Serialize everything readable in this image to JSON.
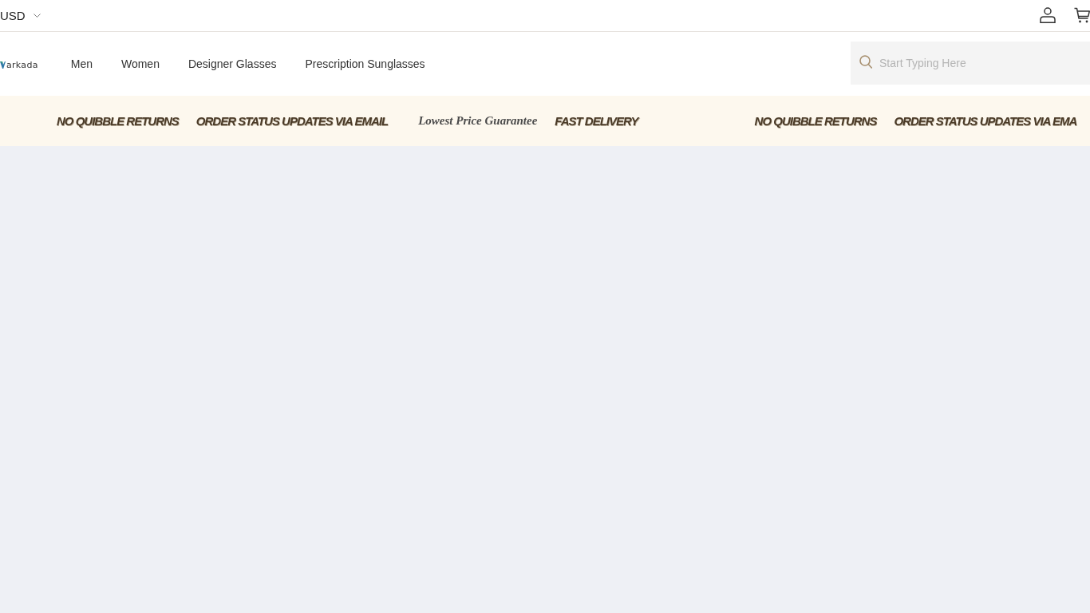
{
  "top_bar": {
    "currency": "USD"
  },
  "header": {
    "logo": {
      "text": "arkada"
    },
    "nav": [
      {
        "label": "Men"
      },
      {
        "label": "Women"
      },
      {
        "label": "Designer Glasses"
      },
      {
        "label": "Prescription Sunglasses"
      }
    ],
    "search": {
      "placeholder": "Start Typing Here"
    }
  },
  "ticker": {
    "groups": [
      {
        "items": [
          {
            "kind": "bold",
            "text": "NO QUIBBLE RETURNS"
          },
          {
            "kind": "bold",
            "text": "ORDER STATUS UPDATES VIA EMAIL"
          },
          {
            "kind": "script",
            "text": "Lowest Price Guarantee"
          },
          {
            "kind": "bold",
            "text": "FAST DELIVERY"
          }
        ]
      },
      {
        "items": [
          {
            "kind": "bold",
            "text": "NO QUIBBLE RETURNS"
          },
          {
            "kind": "bold",
            "text": "ORDER STATUS UPDATES VIA EMA"
          }
        ]
      }
    ]
  }
}
